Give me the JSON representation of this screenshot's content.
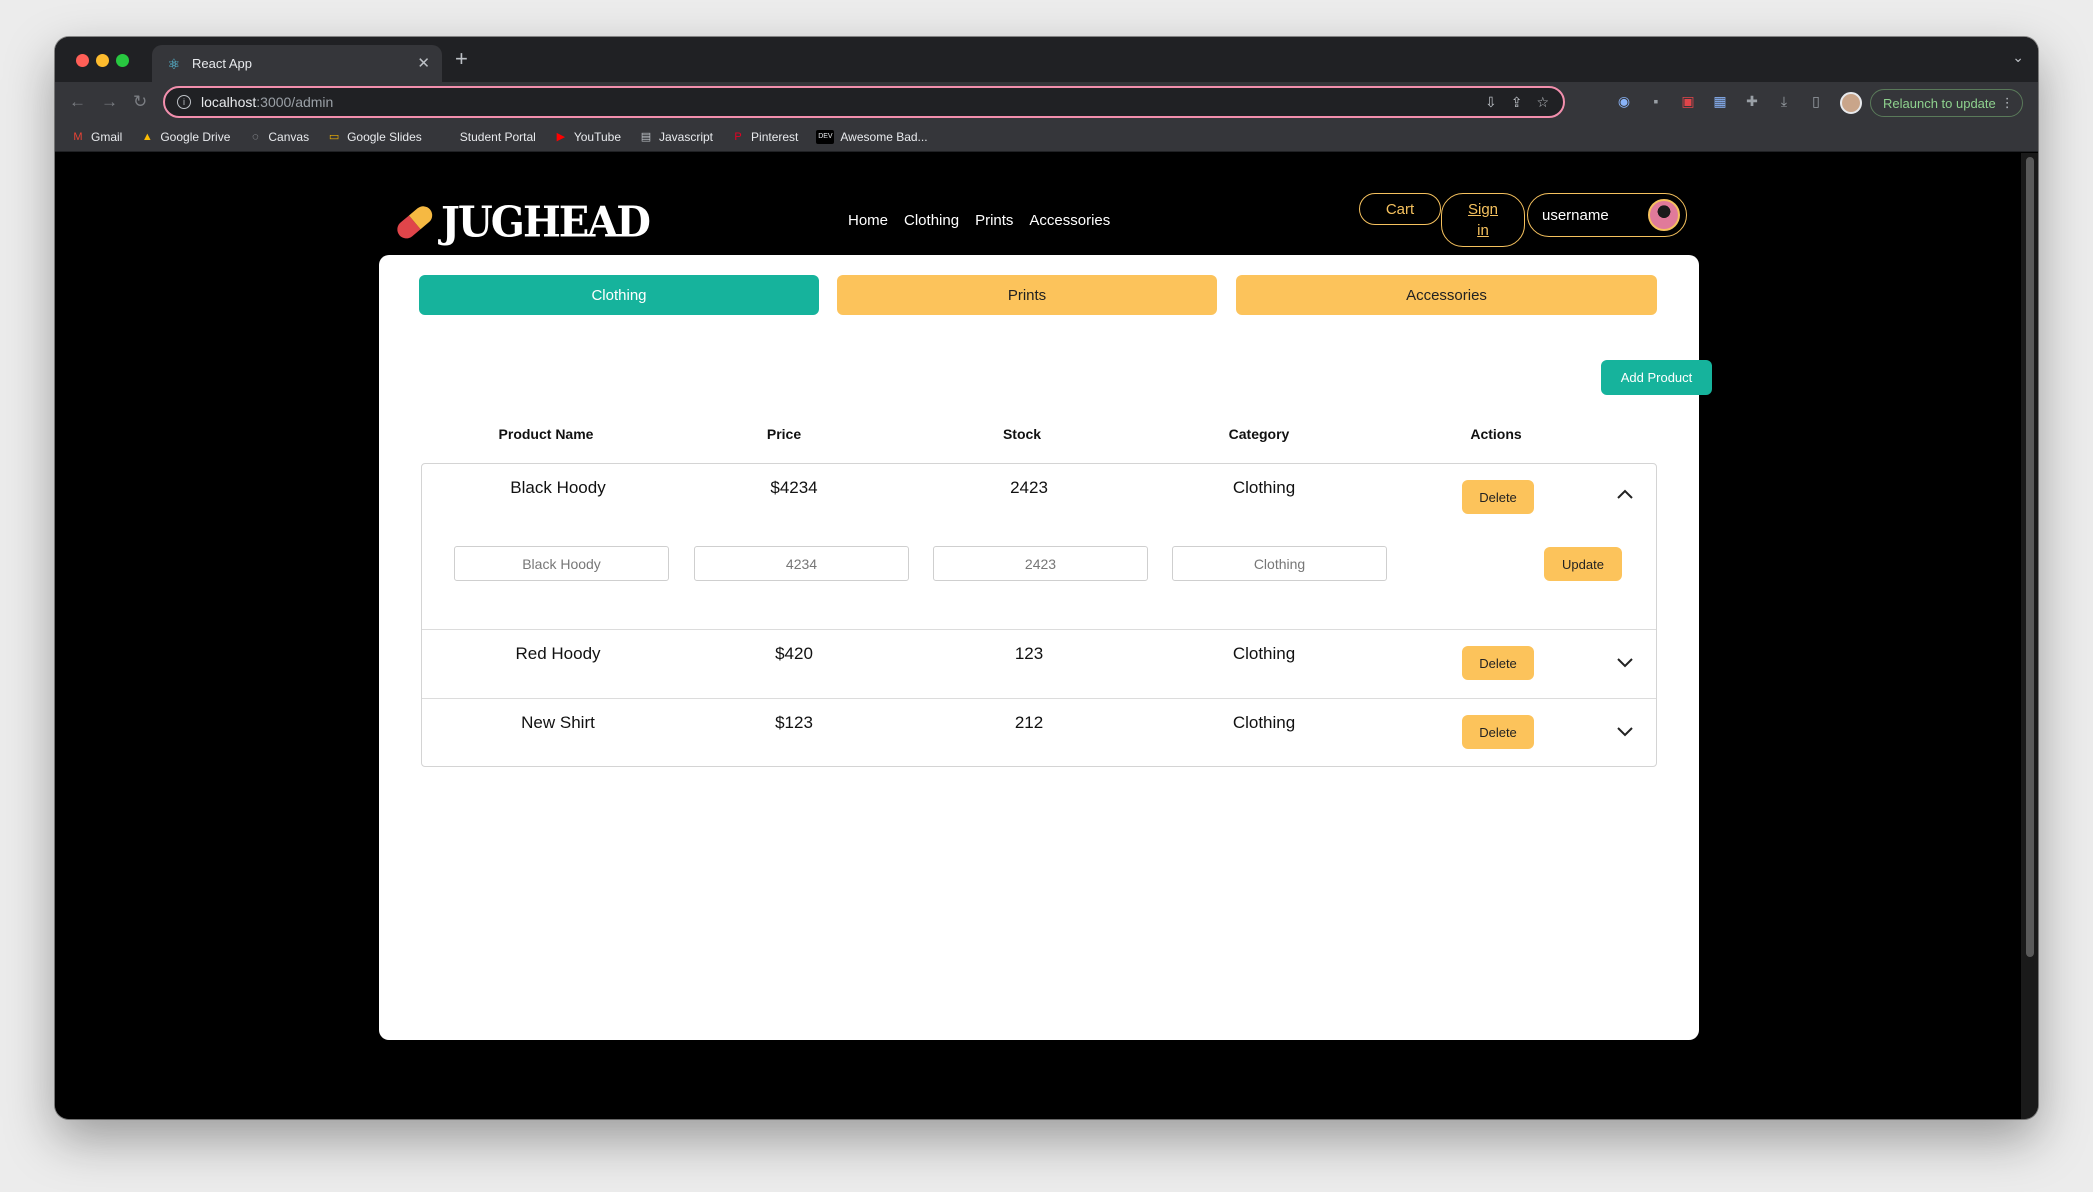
{
  "browser": {
    "tab_title": "React App",
    "new_tab_symbol": "+",
    "url_host": "localhost",
    "url_path": ":3000/admin",
    "relaunch_label": "Relaunch to update",
    "bookmarks": [
      {
        "label": "Gmail",
        "icon": "gmail-icon",
        "glyph": "M",
        "color": "#ea4335"
      },
      {
        "label": "Google Drive",
        "icon": "google-drive-icon",
        "glyph": "▲",
        "color": "#fbbc04"
      },
      {
        "label": "Canvas",
        "icon": "canvas-icon",
        "glyph": "◌",
        "color": "#bdc1c6"
      },
      {
        "label": "Google Slides",
        "icon": "google-slides-icon",
        "glyph": "▭",
        "color": "#f4b400"
      },
      {
        "label": "Student Portal",
        "icon": "student-portal-icon",
        "glyph": "",
        "color": "#35363a"
      },
      {
        "label": "YouTube",
        "icon": "youtube-icon",
        "glyph": "▶",
        "color": "#ff0000"
      },
      {
        "label": "Javascript",
        "icon": "folder-icon",
        "glyph": "▤",
        "color": "#bdc1c6"
      },
      {
        "label": "Pinterest",
        "icon": "pinterest-icon",
        "glyph": "P",
        "color": "#e60023"
      },
      {
        "label": "Awesome Bad...",
        "icon": "dev-icon",
        "glyph": "DEV",
        "color": "#e8eaed"
      }
    ]
  },
  "header": {
    "logo_text": "JUGHEAD",
    "nav": [
      "Home",
      "Clothing",
      "Prints",
      "Accessories"
    ],
    "cart_label": "Cart",
    "signin_line1": "Sign",
    "signin_line2": "in",
    "username": "username"
  },
  "colors": {
    "teal": "#16b39c",
    "yellow": "#fcc35b",
    "pill_border": "#f5c15e"
  },
  "admin": {
    "category_tabs": [
      "Clothing",
      "Prints",
      "Accessories"
    ],
    "active_tab": "Clothing",
    "add_product_label": "Add Product",
    "columns": [
      "Product Name",
      "Price",
      "Stock",
      "Category",
      "Actions"
    ],
    "delete_label": "Delete",
    "update_label": "Update",
    "rows": [
      {
        "name": "Black Hoody",
        "price": "$4234",
        "stock": "2423",
        "category": "Clothing",
        "expanded": true,
        "edit": {
          "name": "Black Hoody",
          "price": "4234",
          "stock": "2423",
          "category": "Clothing"
        }
      },
      {
        "name": "Red Hoody",
        "price": "$420",
        "stock": "123",
        "category": "Clothing",
        "expanded": false
      },
      {
        "name": "New Shirt",
        "price": "$123",
        "stock": "212",
        "category": "Clothing",
        "expanded": false
      }
    ]
  }
}
